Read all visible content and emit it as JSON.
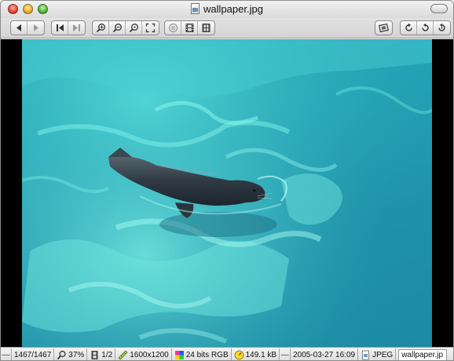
{
  "window": {
    "title": "wallpaper.jpg"
  },
  "toolbar": {
    "groups": [
      [
        "back-button",
        "forward-button"
      ],
      [
        "first-image-button",
        "last-image-button"
      ],
      [
        "zoom-in-button",
        "zoom-out-button",
        "zoom-actual-button",
        "fit-window-button"
      ],
      [
        "slideshow-button",
        "filmstrip-button",
        "browser-button"
      ],
      [
        "screen-mode-button"
      ],
      [
        "rotate-left-button",
        "rotate-reset-button",
        "rotate-right-button"
      ]
    ]
  },
  "statusbar": {
    "left_marker": "—",
    "index": "1467/1467",
    "zoom": "37%",
    "page": "1/2",
    "dimensions": "1600x1200",
    "color_depth": "24 bits RGB",
    "file_size": "149.1 kB",
    "separator": "—",
    "date": "2005-03-27 16:09",
    "format": "JPEG",
    "filename": "wallpaper.jp"
  },
  "colors": {
    "water": "#23a0b3",
    "seal": "#2f3a44",
    "background": "#000000"
  }
}
